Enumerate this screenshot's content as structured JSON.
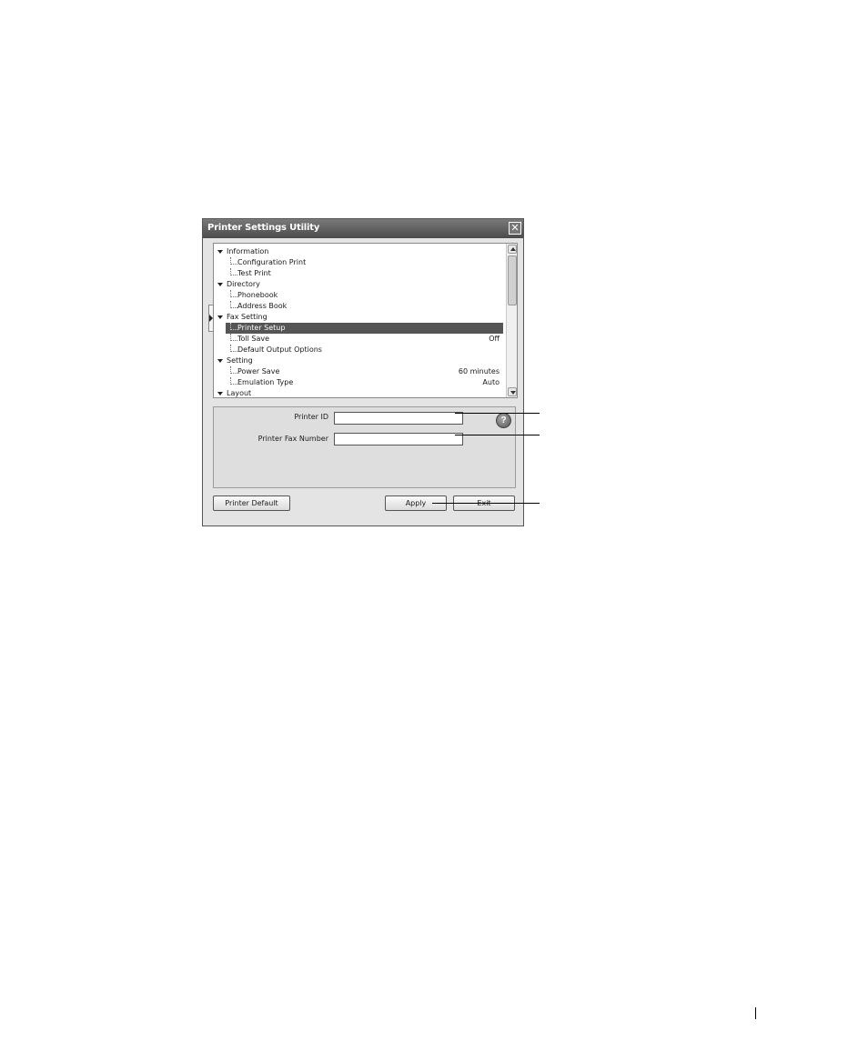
{
  "window": {
    "title": "Printer Settings Utility",
    "close_glyph": "✕"
  },
  "tree": {
    "items": [
      {
        "label": "Information",
        "kind": "category",
        "value": ""
      },
      {
        "label": "Configuration Print",
        "kind": "child",
        "value": ""
      },
      {
        "label": "Test Print",
        "kind": "child",
        "value": ""
      },
      {
        "label": "Directory",
        "kind": "category",
        "value": ""
      },
      {
        "label": "Phonebook",
        "kind": "child",
        "value": ""
      },
      {
        "label": "Address Book",
        "kind": "child",
        "value": ""
      },
      {
        "label": "Fax Setting",
        "kind": "category",
        "value": ""
      },
      {
        "label": "Printer Setup",
        "kind": "child",
        "value": "",
        "selected": true
      },
      {
        "label": "Toll Save",
        "kind": "child",
        "value": "Off"
      },
      {
        "label": "Default Output Options",
        "kind": "child",
        "value": ""
      },
      {
        "label": "Setting",
        "kind": "category",
        "value": ""
      },
      {
        "label": "Power Save",
        "kind": "child",
        "value": "60 minutes"
      },
      {
        "label": "Emulation Type",
        "kind": "child",
        "value": "Auto"
      },
      {
        "label": "Layout",
        "kind": "category",
        "value": ""
      }
    ]
  },
  "form": {
    "printer_id_label": "Printer ID",
    "printer_id_value": "",
    "printer_fax_label": "Printer Fax Number",
    "printer_fax_value": "",
    "help_glyph": "?"
  },
  "buttons": {
    "printer_default": "Printer Default",
    "apply": "Apply",
    "exit": "Exit"
  },
  "icons": {
    "close": "close-icon",
    "help": "help-icon",
    "expand": "triangle-down-icon",
    "side_toggle": "triangle-right-icon"
  }
}
